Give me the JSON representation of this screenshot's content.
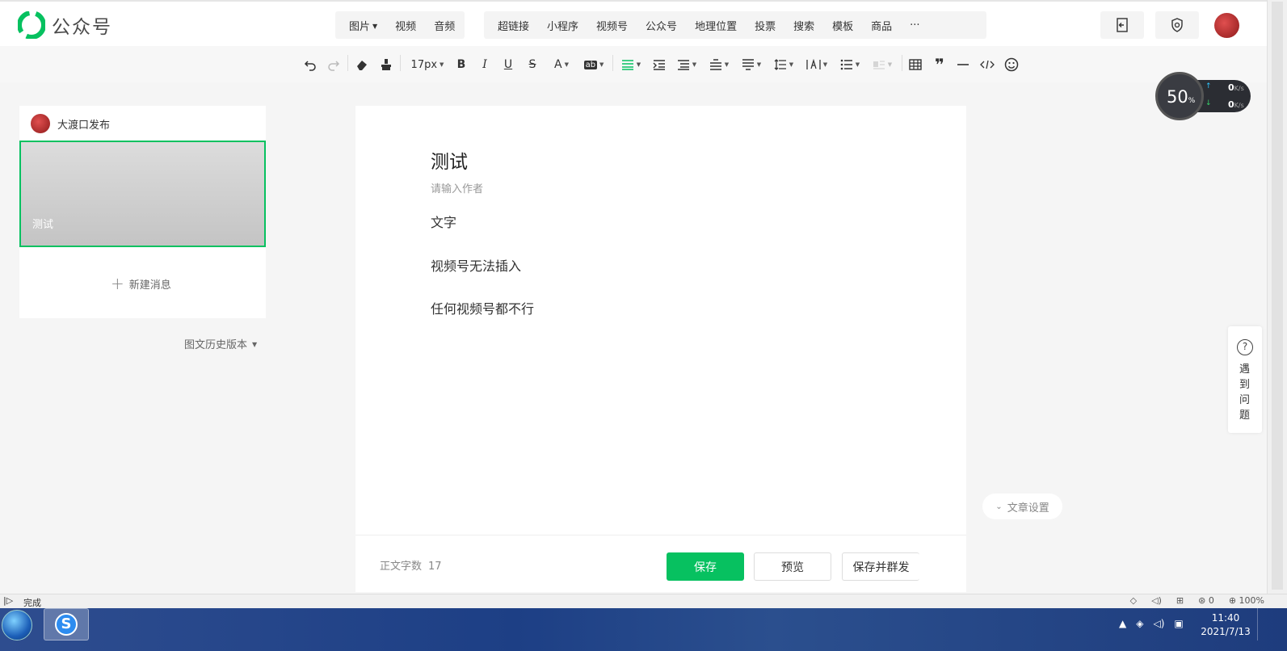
{
  "app": {
    "logo_text": "公众号"
  },
  "topbar": {
    "insert_group1": [
      {
        "label": "图片",
        "caret": true
      },
      {
        "label": "视频",
        "caret": false
      },
      {
        "label": "音频",
        "caret": false
      }
    ],
    "insert_group2": [
      "超链接",
      "小程序",
      "视频号",
      "公众号",
      "地理位置",
      "投票",
      "搜索",
      "模板",
      "商品",
      "···"
    ]
  },
  "toolbar": {
    "font_size": "17px"
  },
  "left_panel": {
    "account_name": "大渡口发布",
    "article_title": "测试",
    "new_message": "新建消息",
    "history": "图文历史版本"
  },
  "editor": {
    "title": "测试",
    "author_placeholder": "请输入作者",
    "paragraphs": [
      "文字",
      "视频号无法插入",
      "任何视频号都不行"
    ],
    "word_count_label": "正文字数",
    "word_count": "17",
    "save": "保存",
    "preview": "预览",
    "save_publish": "保存并群发"
  },
  "article_settings": "文章设置",
  "help": "遇到问题",
  "speed_widget": {
    "percent": "50",
    "percent_unit": "%",
    "up": "0",
    "down": "0",
    "unit": "K/s"
  },
  "statusbar": {
    "status": "完成",
    "adblock_count": "0",
    "zoom": "100%"
  },
  "taskbar": {
    "time": "11:40",
    "date": "2021/7/13"
  },
  "colors": {
    "accent": "#07c160"
  }
}
